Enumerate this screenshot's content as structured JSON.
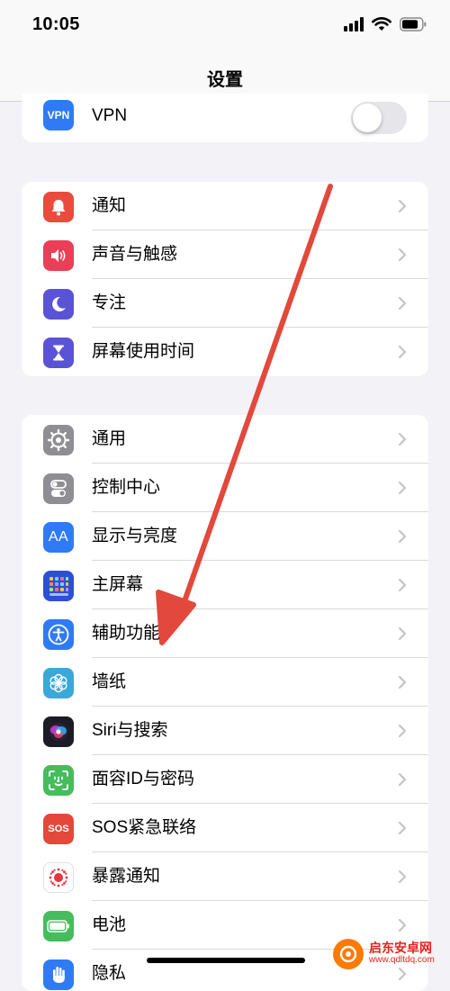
{
  "status": {
    "time": "10:05"
  },
  "nav": {
    "title": "设置"
  },
  "vpn": {
    "icon_text": "VPN",
    "label": "VPN",
    "toggle_on": false
  },
  "group_notifications": [
    {
      "label": "通知",
      "icon": "bell-icon",
      "color": "#ea4b3c"
    },
    {
      "label": "声音与触感",
      "icon": "speaker-icon",
      "color": "#ea3f57"
    },
    {
      "label": "专注",
      "icon": "moon-icon",
      "color": "#5b53d6"
    },
    {
      "label": "屏幕使用时间",
      "icon": "hourglass-icon",
      "color": "#5b53d6"
    }
  ],
  "group_general": [
    {
      "label": "通用",
      "icon": "gear-icon",
      "color": "#8e8e93"
    },
    {
      "label": "控制中心",
      "icon": "switches-icon",
      "color": "#8e8e93"
    },
    {
      "label": "显示与亮度",
      "icon": "text-size-icon",
      "icon_text": "AA",
      "color": "#2f7bf5"
    },
    {
      "label": "主屏幕",
      "icon": "home-grid-icon",
      "color": "#2d4fd6"
    },
    {
      "label": "辅助功能",
      "icon": "accessibility-icon",
      "color": "#2f7bf5"
    },
    {
      "label": "墙纸",
      "icon": "flower-icon",
      "color": "#3aa8d8"
    },
    {
      "label": "Siri与搜索",
      "icon": "siri-icon",
      "color": "#1c1c24"
    },
    {
      "label": "面容ID与密码",
      "icon": "face-id-icon",
      "color": "#45bd5c"
    },
    {
      "label": "SOS紧急联络",
      "icon": "sos-icon",
      "icon_text": "SOS",
      "color": "#e4483a"
    },
    {
      "label": "暴露通知",
      "icon": "exposure-icon",
      "color": "#ffffff"
    },
    {
      "label": "电池",
      "icon": "battery-icon",
      "color": "#45bd5c"
    },
    {
      "label": "隐私",
      "icon": "hand-icon",
      "color": "#2f7bf5"
    }
  ],
  "arrow": {
    "color": "#e2483b"
  },
  "watermark": {
    "title": "启东安卓网",
    "url": "www.qdltdq.com"
  }
}
